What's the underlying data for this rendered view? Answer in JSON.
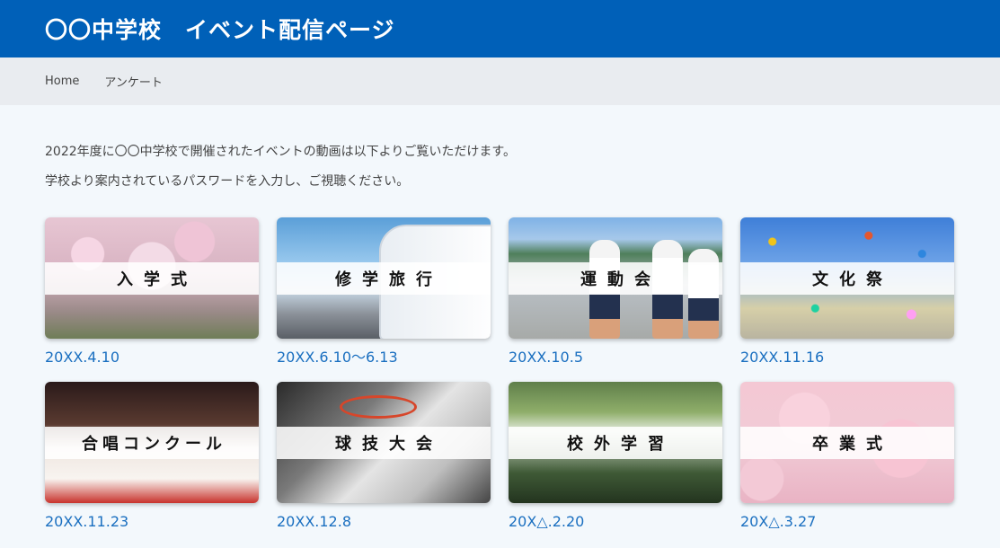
{
  "header": {
    "title": "〇〇中学校　イベント配信ページ"
  },
  "nav": {
    "items": [
      "Home",
      "アンケート"
    ]
  },
  "intro": {
    "line1": "2022年度に〇〇中学校で開催されたイベントの動画は以下よりご覧いただけます。",
    "line2": "学校より案内されているパスワードを入力し、ご視聴ください。"
  },
  "events": [
    {
      "title": "入学式",
      "date": "20XX.4.10",
      "image": "cherry-blossom-image"
    },
    {
      "title": "修学旅行",
      "date": "20XX.6.10〜6.13",
      "image": "bus-image"
    },
    {
      "title": "運動会",
      "date": "20XX.10.5",
      "image": "runners-image"
    },
    {
      "title": "文化祭",
      "date": "20XX.11.16",
      "image": "confetti-image"
    },
    {
      "title": "合唱コンクール",
      "date": "20XX.11.23",
      "image": "sheet-music-image"
    },
    {
      "title": "球技大会",
      "date": "20XX.12.8",
      "image": "basketball-hoop-image"
    },
    {
      "title": "校外学習",
      "date": "20X△.2.20",
      "image": "forest-image"
    },
    {
      "title": "卒業式",
      "date": "20X△.3.27",
      "image": "cherry-blossom-image"
    }
  ]
}
